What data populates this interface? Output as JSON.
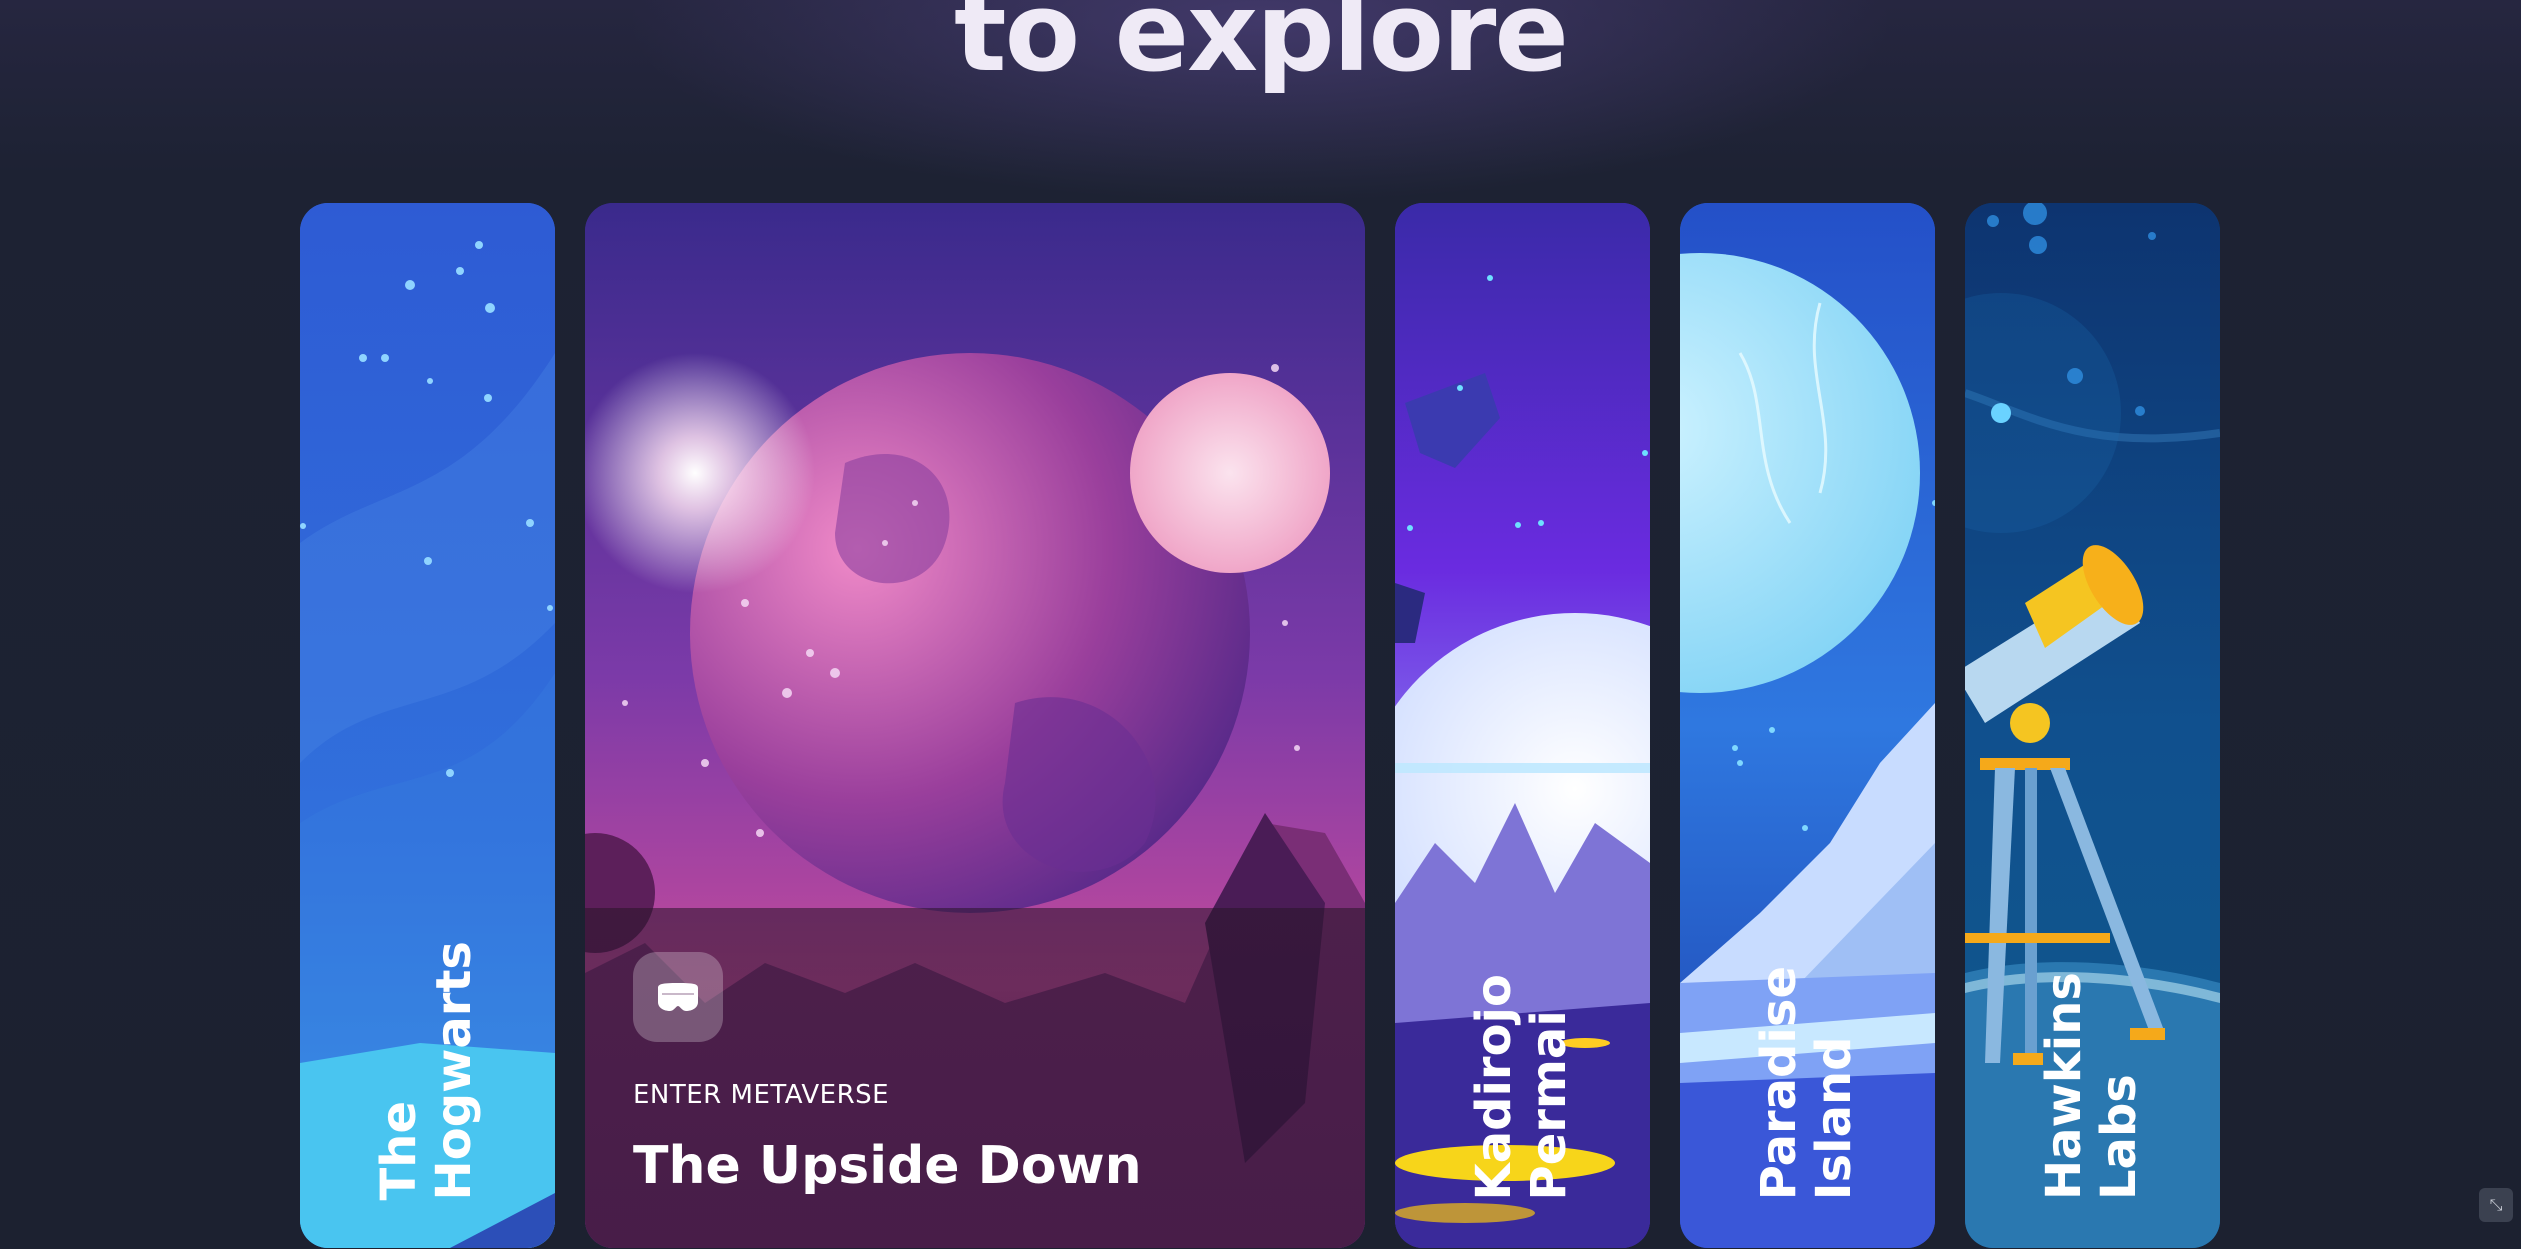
{
  "headline": "to explore",
  "cards": [
    {
      "title_lines": [
        "The",
        "Hogwarts"
      ]
    },
    {
      "enter_label": "ENTER METAVERSE",
      "title": "The Upside Down",
      "icon": "vr-headset-icon"
    },
    {
      "title_lines": [
        "Kadirojo",
        "Permai"
      ]
    },
    {
      "title_lines": [
        "Paradise",
        "Island"
      ]
    },
    {
      "title_lines": [
        "Hawkins",
        "Labs"
      ]
    }
  ],
  "corner_button_glyph": "⤡"
}
